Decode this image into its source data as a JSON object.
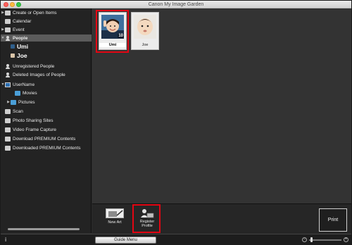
{
  "window": {
    "title": "Canon My Image Garden"
  },
  "sidebar": {
    "items": [
      {
        "label": "Create or Open Items",
        "disclosure": "▶",
        "icon": "create-icon"
      },
      {
        "label": "Calendar",
        "disclosure": "",
        "icon": "calendar-icon"
      },
      {
        "label": "Event",
        "disclosure": "▶",
        "icon": "event-icon"
      },
      {
        "label": "People",
        "disclosure": "▼",
        "icon": "people-icon"
      },
      {
        "label": "Umi",
        "disclosure": "",
        "icon": "umi-thumb-icon"
      },
      {
        "label": "Joe",
        "disclosure": "",
        "icon": "joe-thumb-icon"
      },
      {
        "label": "Unregistered People",
        "disclosure": "",
        "icon": "person-icon"
      },
      {
        "label": "Deleted Images of People",
        "disclosure": "",
        "icon": "person-icon"
      },
      {
        "label": "UserName",
        "disclosure": "▼",
        "icon": "computer-icon"
      },
      {
        "label": "Movies",
        "disclosure": "",
        "icon": "folder-icon"
      },
      {
        "label": "Pictures",
        "disclosure": "▶",
        "icon": "folder-icon"
      },
      {
        "label": "Scan",
        "disclosure": "",
        "icon": "scan-icon"
      },
      {
        "label": "Photo Sharing Sites",
        "disclosure": "",
        "icon": "photo-sharing-icon"
      },
      {
        "label": "Video Frame Capture",
        "disclosure": "",
        "icon": "video-icon"
      },
      {
        "label": "Download PREMIUM Contents",
        "disclosure": "",
        "icon": "download-icon"
      },
      {
        "label": "Downloaded PREMIUM Contents",
        "disclosure": "",
        "icon": "downloaded-icon"
      }
    ]
  },
  "people": [
    {
      "name": "Umi",
      "count": "10",
      "selected": true
    },
    {
      "name": "Joe",
      "count": "",
      "selected": false
    }
  ],
  "toolbar": {
    "new_art_label": "New Art",
    "register_profile_label": "Register\nProfile",
    "print_label": "Print"
  },
  "statusbar": {
    "guide_menu_label": "Guide Menu",
    "info_icon": "i",
    "zoom_level": 0.05
  },
  "colors": {
    "highlight": "#e30613",
    "selection": "#5b5b5b",
    "folder": "#4a9fd8"
  }
}
